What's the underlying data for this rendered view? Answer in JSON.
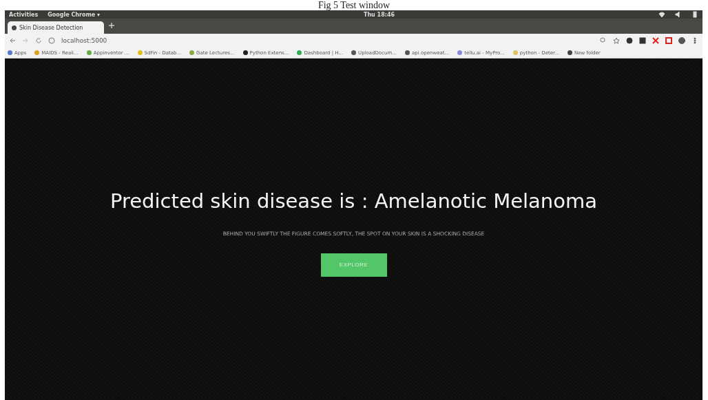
{
  "caption": "Fig 5 Test window",
  "system_bar": {
    "activities": "Activities",
    "app_menu": "Google Chrome ▾",
    "clock": "Thu 18:46"
  },
  "tabs": [
    {
      "title": "Skin Disease Detection",
      "selected": true
    }
  ],
  "address_bar": {
    "url": "localhost:5000"
  },
  "bookmarks": [
    {
      "label": "Apps"
    },
    {
      "label": "MAIDS - Reali..."
    },
    {
      "label": "Appinventor ..."
    },
    {
      "label": "SdFin - Datab..."
    },
    {
      "label": "Gate Lectures..."
    },
    {
      "label": "Python Extens..."
    },
    {
      "label": "Dashboard | H..."
    },
    {
      "label": "UploadDocum..."
    },
    {
      "label": "api.openweat..."
    },
    {
      "label": "tellu.ai - MyPro..."
    },
    {
      "label": "python - Deter..."
    },
    {
      "label": "New folder"
    }
  ],
  "hero": {
    "title": "Predicted skin disease is : Amelanotic Melanoma",
    "subtitle": "BEHIND YOU SWIFTLY THE FIGURE COMES SOFTLY, THE SPOT ON YOUR SKIN IS A SHOCKING DISEASE",
    "button": "EXPLORE"
  }
}
